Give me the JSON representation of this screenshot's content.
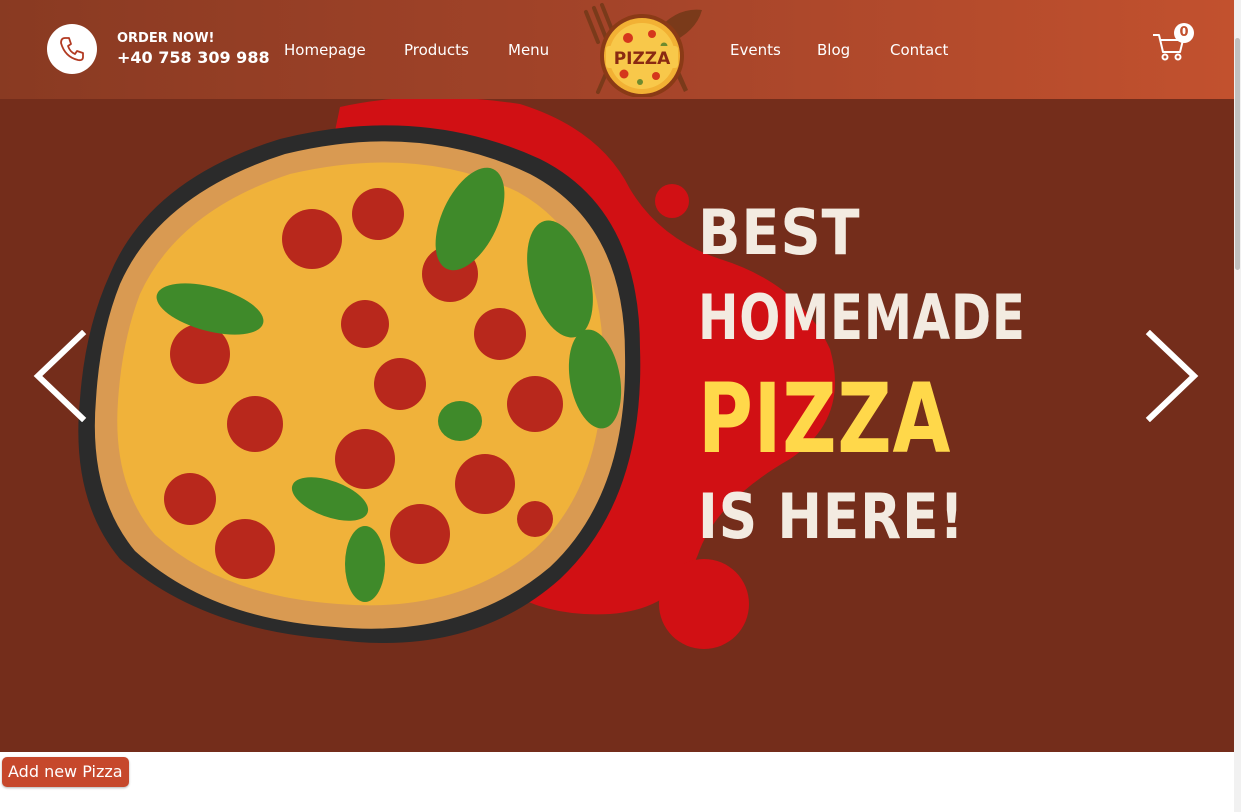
{
  "header": {
    "order_label": "ORDER NOW!",
    "phone": "+40 758 309 988",
    "nav_left": [
      "Homepage",
      "Products",
      "Menu"
    ],
    "nav_right": [
      "Events",
      "Blog",
      "Contact"
    ],
    "logo_text": "PIZZA",
    "cart_count": "0",
    "icons": {
      "phone": "phone-icon",
      "cart": "shopping-cart-icon"
    }
  },
  "hero": {
    "line1": "BEST",
    "line2": "HOMEMADE",
    "line3": "PIZZA",
    "line4": "IS HERE!",
    "image": "pepperoni-pizza-image",
    "prev_icon": "chevron-left-icon",
    "next_icon": "chevron-right-icon"
  },
  "actions": {
    "add_button": "Add new Pizza"
  },
  "colors": {
    "header_from": "#893a22",
    "header_to": "#c2512e",
    "hero_bg": "#742d1b",
    "splash": "#d11014",
    "headline": "#f3ebe1",
    "accent": "#ffd84a",
    "button": "#c6482c"
  }
}
